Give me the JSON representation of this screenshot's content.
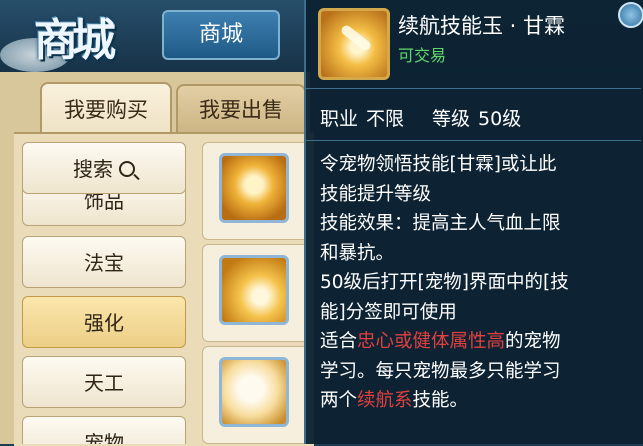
{
  "header": {
    "logo_text": "商城",
    "tab_label": "商城"
  },
  "shop": {
    "buy_tab": "我要购买",
    "sell_tab": "我要出售",
    "categories": [
      {
        "label": "搜索",
        "icon": "search-icon"
      },
      {
        "label": "饰品"
      },
      {
        "label": "法宝"
      },
      {
        "label": "强化",
        "active": true
      },
      {
        "label": "天工"
      },
      {
        "label": "宠物"
      }
    ],
    "items": [
      {
        "icon": "ornament-icon"
      },
      {
        "icon": "skill-jade-icon"
      },
      {
        "icon": "pearl-icon"
      }
    ]
  },
  "tooltip": {
    "item_name": "续航技能玉 · 甘霖",
    "tradable": "可交易",
    "class_label": "职业",
    "class_value": "不限",
    "level_label": "等级",
    "level_value": "50级",
    "desc": {
      "line1": "令宠物领悟技能[甘霖]或让此",
      "line2": "技能提升等级",
      "line3": "技能效果：提高主人气血上限",
      "line4": "和暴抗。",
      "line5": "50级后打开[宠物]界面中的[技",
      "line6": "能]分签即可使用",
      "line7_pre": "适合",
      "line7_red": "忠心或健体属性高",
      "line7_post": "的宠物",
      "line8": "学习。每只宠物最多只能学习",
      "line9_pre": "两个",
      "line9_red": "续航系",
      "line9_post": "技能。"
    }
  },
  "colors": {
    "tradable_green": "#5fd96b",
    "highlight_red": "#e0403e",
    "tooltip_bg": "#0c2232"
  }
}
